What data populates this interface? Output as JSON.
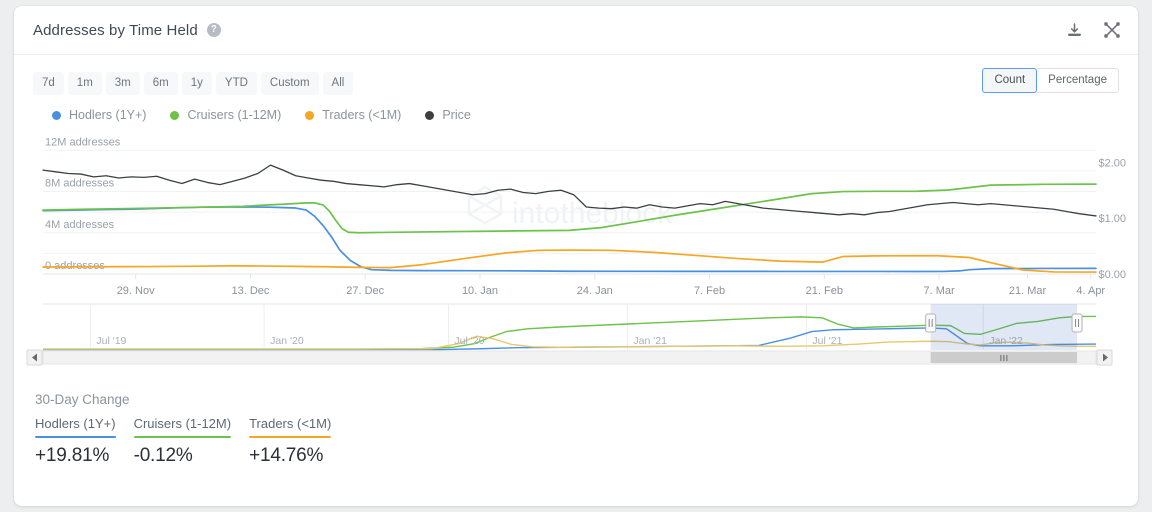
{
  "header": {
    "title": "Addresses by Time Held",
    "help_icon": "question-mark-icon",
    "download_icon": "download-icon",
    "expand_icon": "expand-icon"
  },
  "toolbar": {
    "ranges": [
      "7d",
      "1m",
      "3m",
      "6m",
      "1y",
      "YTD",
      "Custom",
      "All"
    ],
    "units": [
      {
        "label": "Count",
        "active": true
      },
      {
        "label": "Percentage",
        "active": false
      }
    ]
  },
  "legend": [
    {
      "label": "Hodlers (1Y+)",
      "color": "#4a90e2"
    },
    {
      "label": "Cruisers (1-12M)",
      "color": "#6cc24a"
    },
    {
      "label": "Traders (<1M)",
      "color": "#f5a623"
    },
    {
      "label": "Price",
      "color": "#3c4043"
    }
  ],
  "watermark": "intotheblock",
  "chart_data": {
    "type": "line",
    "title": "Addresses by Time Held",
    "xlabel": "",
    "ylabel": "addresses",
    "y_left_ticks": [
      "0 addresses",
      "4M addresses",
      "8M addresses",
      "12M addresses"
    ],
    "y_left_values": [
      0,
      4000000,
      8000000,
      12000000
    ],
    "ylim": [
      0,
      13000000
    ],
    "y_right_ticks": [
      "$0.00",
      "$1.00",
      "$2.00"
    ],
    "y_right_values": [
      0,
      1,
      2
    ],
    "y_right_lim": [
      0,
      2.4
    ],
    "x_ticks": [
      "29. Nov",
      "13. Dec",
      "27. Dec",
      "10. Jan",
      "24. Jan",
      "7. Feb",
      "21. Feb",
      "7. Mar",
      "21. Mar",
      "4. Apr"
    ],
    "x_tick_positions": [
      0.088,
      0.197,
      0.306,
      0.415,
      0.524,
      0.633,
      0.742,
      0.851,
      0.935,
      0.995
    ],
    "grid": true,
    "legend_position": "top-left",
    "series": [
      {
        "name": "Hodlers (1Y+)",
        "color": "#4a90e2",
        "axis": "left",
        "x": [
          0.0,
          0.03,
          0.06,
          0.09,
          0.12,
          0.15,
          0.175,
          0.2,
          0.215,
          0.225,
          0.24,
          0.25,
          0.258,
          0.266,
          0.274,
          0.282,
          0.292,
          0.302,
          0.312,
          0.33,
          0.36,
          0.4,
          0.44,
          0.47,
          0.5,
          0.56,
          0.62,
          0.7,
          0.76,
          0.8,
          0.83,
          0.855,
          0.87,
          0.88,
          0.9,
          0.95,
          1.0
        ],
        "y": [
          6150000,
          6200000,
          6250000,
          6300000,
          6400000,
          6480000,
          6500000,
          6500000,
          6480000,
          6450000,
          6400000,
          6200000,
          5600000,
          4700000,
          3600000,
          2300000,
          1300000,
          700000,
          420000,
          350000,
          330000,
          320000,
          310000,
          290000,
          270000,
          260000,
          255000,
          250000,
          248000,
          246000,
          244000,
          250000,
          300000,
          420000,
          520000,
          540000,
          545000
        ]
      },
      {
        "name": "Cruisers (1-12M)",
        "color": "#6cc24a",
        "axis": "left",
        "x": [
          0.0,
          0.04,
          0.08,
          0.12,
          0.16,
          0.19,
          0.21,
          0.23,
          0.25,
          0.258,
          0.266,
          0.272,
          0.278,
          0.284,
          0.29,
          0.3,
          0.32,
          0.36,
          0.4,
          0.45,
          0.5,
          0.53,
          0.56,
          0.6,
          0.65,
          0.7,
          0.73,
          0.76,
          0.79,
          0.81,
          0.83,
          0.86,
          0.9,
          0.95,
          1.0
        ],
        "y": [
          6200000,
          6280000,
          6350000,
          6420000,
          6500000,
          6560000,
          6680000,
          6780000,
          6900000,
          6900000,
          6700000,
          6100000,
          5200000,
          4400000,
          4050000,
          4000000,
          4030000,
          4080000,
          4130000,
          4180000,
          4230000,
          4500000,
          5000000,
          5700000,
          6500000,
          7300000,
          7800000,
          8000000,
          8020000,
          8020000,
          8030000,
          8150000,
          8620000,
          8700000,
          8720000
        ]
      },
      {
        "name": "Traders (<1M)",
        "color": "#f5a623",
        "axis": "left",
        "x": [
          0.0,
          0.05,
          0.1,
          0.15,
          0.18,
          0.21,
          0.24,
          0.27,
          0.3,
          0.33,
          0.36,
          0.4,
          0.44,
          0.47,
          0.5,
          0.54,
          0.58,
          0.62,
          0.66,
          0.7,
          0.74,
          0.76,
          0.79,
          0.82,
          0.85,
          0.88,
          0.9,
          0.93,
          0.96,
          1.0
        ],
        "y": [
          680000,
          700000,
          720000,
          760000,
          800000,
          770000,
          740000,
          700000,
          640000,
          620000,
          900000,
          1500000,
          2050000,
          2300000,
          2320000,
          2300000,
          2100000,
          1800000,
          1500000,
          1250000,
          1150000,
          1700000,
          1760000,
          1770000,
          1770000,
          1600000,
          1100000,
          400000,
          200000,
          190000
        ]
      },
      {
        "name": "Price",
        "color": "#3c4043",
        "axis": "right",
        "x": [
          0.0,
          0.012,
          0.024,
          0.036,
          0.048,
          0.06,
          0.072,
          0.084,
          0.096,
          0.108,
          0.12,
          0.132,
          0.144,
          0.156,
          0.168,
          0.18,
          0.192,
          0.204,
          0.216,
          0.228,
          0.24,
          0.252,
          0.264,
          0.276,
          0.288,
          0.3,
          0.312,
          0.324,
          0.336,
          0.348,
          0.36,
          0.372,
          0.384,
          0.396,
          0.408,
          0.42,
          0.432,
          0.444,
          0.456,
          0.468,
          0.48,
          0.492,
          0.504,
          0.516,
          0.528,
          0.54,
          0.552,
          0.564,
          0.576,
          0.588,
          0.6,
          0.612,
          0.624,
          0.636,
          0.648,
          0.66,
          0.672,
          0.684,
          0.696,
          0.708,
          0.72,
          0.732,
          0.744,
          0.756,
          0.768,
          0.78,
          0.792,
          0.804,
          0.816,
          0.828,
          0.84,
          0.852,
          0.864,
          0.876,
          0.888,
          0.9,
          0.912,
          0.924,
          0.936,
          0.948,
          0.96,
          0.972,
          0.984,
          1.0
        ],
        "y": [
          1.86,
          1.83,
          1.8,
          1.79,
          1.74,
          1.76,
          1.72,
          1.74,
          1.73,
          1.75,
          1.68,
          1.62,
          1.7,
          1.64,
          1.6,
          1.66,
          1.72,
          1.8,
          1.95,
          1.86,
          1.76,
          1.72,
          1.68,
          1.66,
          1.62,
          1.6,
          1.58,
          1.56,
          1.6,
          1.62,
          1.58,
          1.54,
          1.5,
          1.46,
          1.42,
          1.44,
          1.5,
          1.52,
          1.46,
          1.44,
          1.48,
          1.5,
          1.42,
          1.2,
          1.18,
          1.17,
          1.2,
          1.18,
          1.24,
          1.2,
          1.18,
          1.22,
          1.26,
          1.24,
          1.3,
          1.26,
          1.22,
          1.18,
          1.16,
          1.14,
          1.12,
          1.1,
          1.08,
          1.06,
          1.08,
          1.06,
          1.1,
          1.12,
          1.16,
          1.2,
          1.24,
          1.26,
          1.28,
          1.26,
          1.24,
          1.26,
          1.24,
          1.22,
          1.2,
          1.18,
          1.16,
          1.12,
          1.08,
          1.04
        ]
      }
    ]
  },
  "navigator": {
    "x_ticks": [
      "Jul '19",
      "Jan '20",
      "Jul '20",
      "Jan '21",
      "Jul '21",
      "Jan '22"
    ],
    "x_tick_positions": [
      0.045,
      0.21,
      0.385,
      0.555,
      0.725,
      0.893
    ],
    "selection": {
      "start": 0.843,
      "end": 0.982
    },
    "series": [
      {
        "name": "Cruisers (1-12M)",
        "color": "#6cc24a",
        "x": [
          0.0,
          0.1,
          0.2,
          0.3,
          0.36,
          0.39,
          0.41,
          0.425,
          0.44,
          0.46,
          0.49,
          0.55,
          0.62,
          0.69,
          0.72,
          0.74,
          0.755,
          0.77,
          0.79,
          0.82,
          0.843,
          0.862,
          0.875,
          0.89,
          0.905,
          0.925,
          0.945,
          0.965,
          0.982,
          1.0
        ],
        "y": [
          0.02,
          0.02,
          0.02,
          0.02,
          0.03,
          0.06,
          0.14,
          0.28,
          0.4,
          0.46,
          0.5,
          0.56,
          0.63,
          0.7,
          0.72,
          0.7,
          0.56,
          0.48,
          0.5,
          0.52,
          0.54,
          0.53,
          0.36,
          0.34,
          0.44,
          0.58,
          0.62,
          0.7,
          0.73,
          0.73
        ]
      },
      {
        "name": "Hodlers (1Y+)",
        "color": "#4a90e2",
        "x": [
          0.0,
          0.2,
          0.38,
          0.42,
          0.45,
          0.5,
          0.6,
          0.68,
          0.71,
          0.73,
          0.75,
          0.775,
          0.8,
          0.82,
          0.843,
          0.858,
          0.868,
          0.878,
          0.89,
          0.92,
          0.96,
          1.0
        ],
        "y": [
          0.01,
          0.01,
          0.01,
          0.03,
          0.05,
          0.06,
          0.08,
          0.1,
          0.26,
          0.4,
          0.44,
          0.45,
          0.46,
          0.47,
          0.48,
          0.46,
          0.3,
          0.14,
          0.09,
          0.09,
          0.12,
          0.13
        ]
      },
      {
        "name": "Traders (<1M)",
        "color": "#e8c86a",
        "x": [
          0.0,
          0.15,
          0.3,
          0.37,
          0.395,
          0.412,
          0.428,
          0.445,
          0.465,
          0.49,
          0.53,
          0.6,
          0.66,
          0.7,
          0.74,
          0.775,
          0.8,
          0.82,
          0.843,
          0.86,
          0.878,
          0.89,
          0.905,
          0.918,
          0.935,
          0.95,
          0.965,
          0.982,
          1.0
        ],
        "y": [
          0.02,
          0.02,
          0.02,
          0.03,
          0.14,
          0.3,
          0.24,
          0.12,
          0.07,
          0.06,
          0.07,
          0.08,
          0.09,
          0.08,
          0.09,
          0.13,
          0.17,
          0.18,
          0.19,
          0.18,
          0.13,
          0.11,
          0.16,
          0.17,
          0.15,
          0.11,
          0.09,
          0.08,
          0.08
        ]
      }
    ]
  },
  "stats": {
    "title": "30-Day Change",
    "items": [
      {
        "label": "Hodlers (1Y+)",
        "value": "+19.81%",
        "color": "#4a90e2"
      },
      {
        "label": "Cruisers (1-12M)",
        "value": "-0.12%",
        "color": "#6cc24a"
      },
      {
        "label": "Traders (<1M)",
        "value": "+14.76%",
        "color": "#f5a623"
      }
    ]
  }
}
